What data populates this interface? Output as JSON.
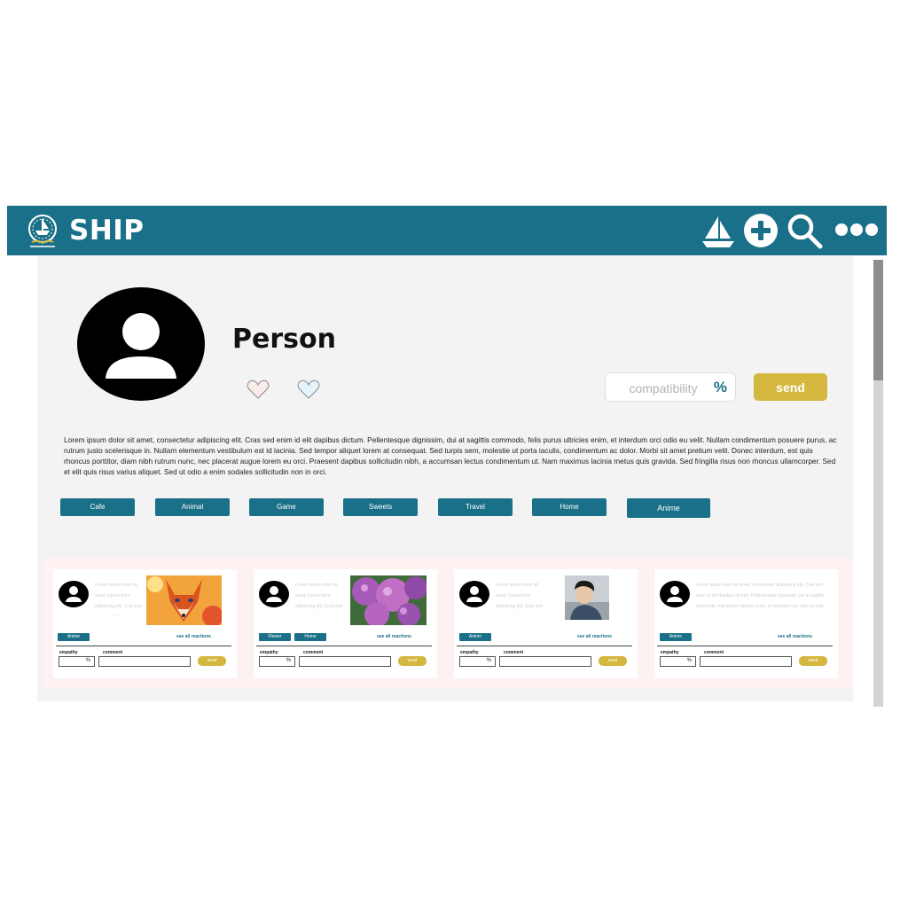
{
  "header": {
    "brand": "SHIP",
    "icons": [
      "logo-icon",
      "ship-icon",
      "add-circle-icon",
      "search-icon",
      "more-dots-icon"
    ],
    "background": "#1a7088"
  },
  "profile": {
    "name": "Person",
    "compat_placeholder": "compatibility",
    "compat_unit": "%",
    "send_label": "send",
    "bio": "Lorem ipsum dolor sit amet, consectetur adipiscing elit. Cras sed enim id elit dapibus dictum. Pellentesque dignissim, dui at sagittis commodo, felis purus ultricies enim, et interdum orci odio eu velit. Nullam condimentum posuere purus, ac rutrum justo scelerisque in. Nullam elementum vestibulum est id lacinia. Sed tempor aliquet lorem at consequat. Sed turpis sem, molestie ut porta iaculis, condimentum ac dolor. Morbi sit amet pretium velit. Donec interdum, est quis rhoncus porttitor, diam nibh rutrum nunc, nec placerat augue lorem eu orci. Praesent dapibus sollicitudin nibh, a accumsan lectus condimentum ut. Nam maximus lacinia metus quis gravida. Sed fringilla risus non rhoncus ullamcorper. Sed et elit quis risus varius aliquet. Sed ut odio a enim sodales sollicitudin non in orci.",
    "tags": [
      "Cafe",
      "Animal",
      "Game",
      "Sweets",
      "Travel",
      "Home",
      "Anime"
    ]
  },
  "cards": [
    {
      "text": "Lorem ipsum dolor sit amet, consectetur adipiscing elit. Cras sed enim id elit dapibus dictum.",
      "image": "fox-image",
      "tags": [
        "Anime"
      ],
      "see_all": "see all reactions",
      "empathy_label": "empathy",
      "comment_label": "comment",
      "unit": "%",
      "send_label": "send"
    },
    {
      "text": "Lorem ipsum dolor sit amet, consectetur adipiscing elit. Cras sed enim id elit.",
      "image": "hydrangea-image",
      "tags": [
        "Flower",
        "Home"
      ],
      "see_all": "see all reactions",
      "empathy_label": "empathy",
      "comment_label": "comment",
      "unit": "%",
      "send_label": "send"
    },
    {
      "text": "Lorem ipsum dolor sit amet, consectetur adipiscing elit. Cras sed enim id elit.",
      "image": "person-photo",
      "tags": [
        "Anime"
      ],
      "see_all": "see all reactions",
      "empathy_label": "empathy",
      "comment_label": "comment",
      "unit": "%",
      "send_label": "send"
    },
    {
      "text": "Lorem ipsum dolor sit amet, consectetur adipiscing elit. Cras sed enim id elit dapibus dictum. Pellentesque dignissim, dui at sagittis commodo, felis purus ultricies enim, et interdum orci odio eu velit.",
      "image": "",
      "tags": [
        "Anime"
      ],
      "see_all": "see all reactions",
      "empathy_label": "empathy",
      "comment_label": "comment",
      "unit": "%",
      "send_label": "send"
    }
  ],
  "colors": {
    "accent": "#1a7088",
    "send": "#d4b73f",
    "panel": "#f3f3f3",
    "cards_background": "#fdf1f1"
  }
}
